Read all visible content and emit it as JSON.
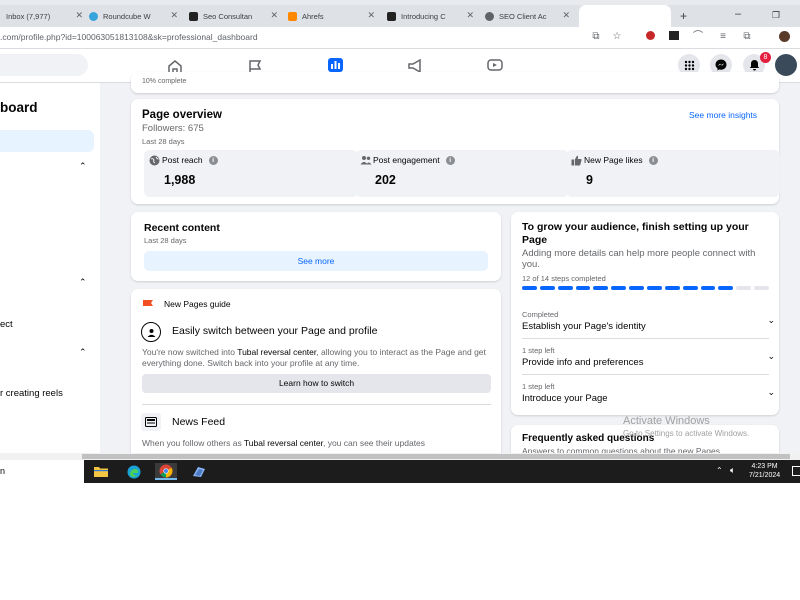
{
  "browser": {
    "tabs": [
      {
        "label": "Inbox (7,977)",
        "color": "#ea4335"
      },
      {
        "label": "Roundcube W",
        "color": "#37a4db"
      },
      {
        "label": "Seo Consultan",
        "color": "#222222"
      },
      {
        "label": "Ahrefs",
        "color": "#ff8800"
      },
      {
        "label": "Introducing C",
        "color": "#222222"
      },
      {
        "label": "SEO Client Ac",
        "color": "#5f6368"
      }
    ],
    "new_tab": "+",
    "url": ".com/profile.php?id=100063051813108&sk=professional_dashboard"
  },
  "facebook": {
    "notification_count": "8"
  },
  "sidebar": {
    "title": "board",
    "item_a": "ect",
    "item_b": "r creating reels"
  },
  "top_card": {
    "cut_text": "10% complete"
  },
  "overview": {
    "title": "Page overview",
    "followers": "Followers: 675",
    "period": "Last 28 days",
    "see_more": "See more insights",
    "stats": [
      {
        "label": "Post reach",
        "value": "1,988",
        "icon": "globe-icon"
      },
      {
        "label": "Post engagement",
        "value": "202",
        "icon": "people-icon"
      },
      {
        "label": "New Page likes",
        "value": "9",
        "icon": "thumbs-up-icon"
      }
    ]
  },
  "recent": {
    "title": "Recent content",
    "period": "Last 28 days",
    "button": "See more"
  },
  "guide": {
    "title": "New Pages guide",
    "item1_title": "Easily switch between your Page and profile",
    "item1_desc_a": "You're now switched into ",
    "item1_desc_name": "Tubal reversal center",
    "item1_desc_b": ", allowing you to interact as the Page and get everything done. Switch back into your profile at any time.",
    "item1_button": "Learn how to switch",
    "item2_title": "News Feed",
    "item2_desc_a": "When you follow others as ",
    "item2_desc_name": "Tubal reversal center",
    "item2_desc_b": ", you can see their updates"
  },
  "grow": {
    "title": "To grow your audience, finish setting up your Page",
    "desc": "Adding more details can help more people connect with you.",
    "progress_text": "12 of 14 steps completed",
    "progress_completed": 12,
    "progress_total": 14,
    "accent": "#0866ff",
    "steps": [
      {
        "status": "Completed",
        "label": "Establish your Page's identity"
      },
      {
        "status": "1 step left",
        "label": "Provide info and preferences"
      },
      {
        "status": "1 step left",
        "label": "Introduce your Page"
      }
    ]
  },
  "faq": {
    "title": "Frequently asked questions",
    "desc": "Answers to common questions about the new Pages"
  },
  "watermark": {
    "line1": "Activate Windows",
    "line2": "Go to Settings to activate Windows."
  },
  "taskbar": {
    "left_text": "n",
    "time": "4:23 PM",
    "date": "7/21/2024"
  }
}
